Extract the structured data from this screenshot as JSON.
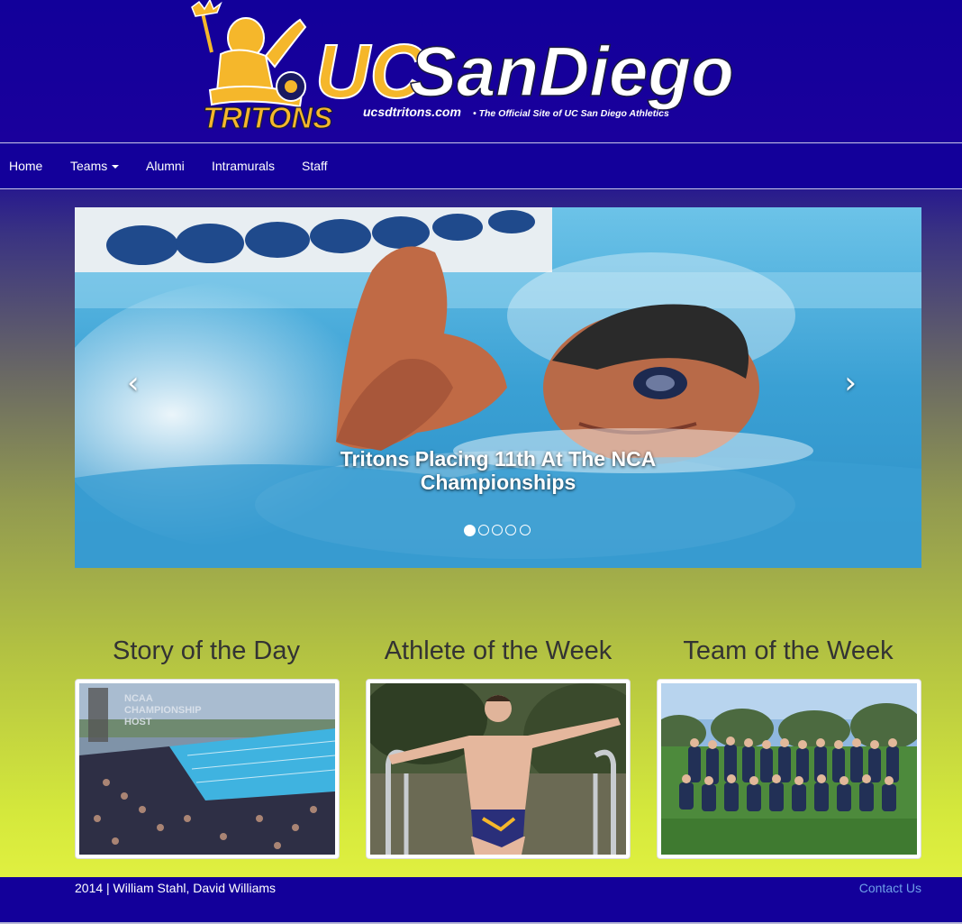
{
  "brand": {
    "logo_main": "UCSanDiego",
    "logo_sub": "TRITONS",
    "logo_url_text": "ucsdtritons.com",
    "logo_tagline": "• The Official Site of UC San Diego Athletics",
    "colors": {
      "navy": "#13009a",
      "gold": "#f5b72b",
      "white": "#ffffff"
    }
  },
  "nav": {
    "items": [
      {
        "label": "Home"
      },
      {
        "label": "Teams",
        "dropdown": true
      },
      {
        "label": "Alumni"
      },
      {
        "label": "Intramurals"
      },
      {
        "label": "Staff"
      }
    ]
  },
  "carousel": {
    "caption": "Tritons Placing 11th At The NCA Championships",
    "prev_icon": "chevron-left-icon",
    "next_icon": "chevron-right-icon",
    "slide_count": 5,
    "active_slide": 1
  },
  "features": [
    {
      "title": "Story of the Day",
      "image_text": "NCAA CHAMPIONSHIP HOST"
    },
    {
      "title": "Athlete of the Week"
    },
    {
      "title": "Team of the Week"
    }
  ],
  "footer": {
    "credits": "2014 | William Stahl, David Williams",
    "contact": "Contact Us"
  }
}
